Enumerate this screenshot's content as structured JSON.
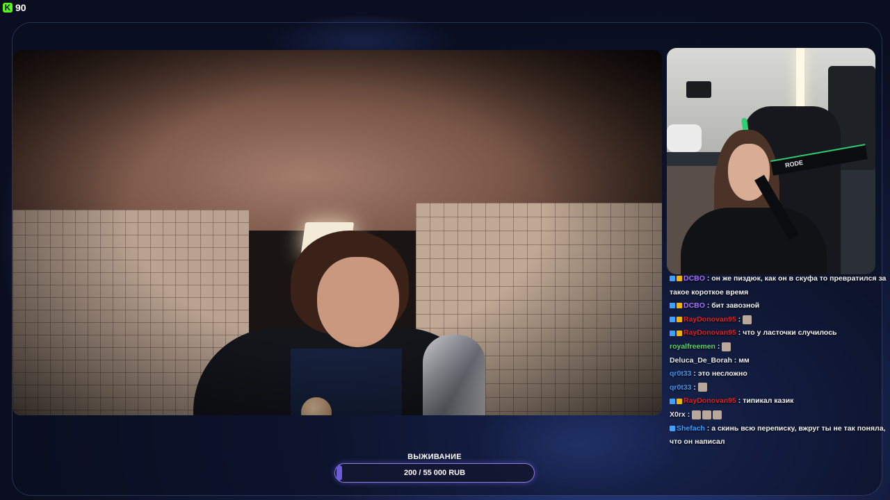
{
  "badge": {
    "value": "90",
    "icon": "kick-logo-icon",
    "color": "#53fc18"
  },
  "goal": {
    "title": "ВЫЖИВАНИЕ",
    "progress_text": "200 / 55 000 RUB",
    "progress_fraction": 0.0036,
    "accent": "#8a7de0"
  },
  "webcam": {
    "mic_label": "RODE"
  },
  "chat": {
    "messages": [
      {
        "badges": [
          "blue",
          "gold"
        ],
        "user": "DCBO",
        "user_color": "#a970ff",
        "text": "он же пиздюк, как он в скуфа то превратился за",
        "continuation": "такое короткое время"
      },
      {
        "badges": [
          "blue",
          "gold"
        ],
        "user": "DCBO",
        "user_color": "#a970ff",
        "text": "бит завозной"
      },
      {
        "badges": [
          "blue",
          "gold"
        ],
        "user": "RayDonovan95",
        "user_color": "#e02020",
        "text": "",
        "emote": "ghost-emote"
      },
      {
        "badges": [
          "blue",
          "gold"
        ],
        "user": "RayDonovan95",
        "user_color": "#e02020",
        "text": "что у ласточки случилось"
      },
      {
        "badges": [],
        "user": "royalfreemen",
        "user_color": "#5fd36a",
        "text": "",
        "emote": "cat-emote"
      },
      {
        "badges": [],
        "user": "Deluca_De_Borah",
        "user_color": "#e8e8e8",
        "text": "мм"
      },
      {
        "badges": [],
        "user": "qr0t33",
        "user_color": "#4a8fe0",
        "text": "это несложно"
      },
      {
        "badges": [],
        "user": "qr0t33",
        "user_color": "#4a8fe0",
        "text": "",
        "emote": "face-emote"
      },
      {
        "badges": [
          "blue",
          "gold"
        ],
        "user": "RayDonovan95",
        "user_color": "#e02020",
        "text": "типикал казик"
      },
      {
        "badges": [],
        "user": "X0rx",
        "user_color": "#e8e8e8",
        "text": "",
        "emote_count": 3,
        "emote": "rocket-emote"
      },
      {
        "badges": [
          "blue"
        ],
        "user": "Shefach",
        "user_color": "#3fa0ff",
        "text": "а скинь всю переписку, вжруг ты не так поняла,",
        "continuation": "что он написал"
      }
    ]
  }
}
